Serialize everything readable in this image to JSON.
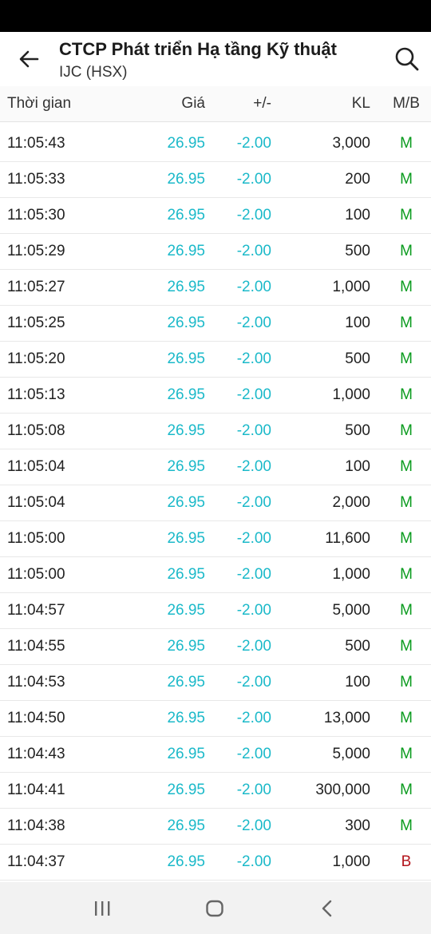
{
  "header": {
    "title": "CTCP Phát triển Hạ tầng Kỹ thuật",
    "subtitle": "IJC (HSX)",
    "back_icon": "arrow-left-icon",
    "search_icon": "search-icon"
  },
  "table": {
    "columns": {
      "time": "Thời gian",
      "price": "Giá",
      "change": "+/-",
      "volume": "KL",
      "side": "M/B"
    },
    "rows": [
      {
        "time": "11:05:43",
        "price": "26.95",
        "change": "-2.00",
        "volume": "3,000",
        "side": "M"
      },
      {
        "time": "11:05:33",
        "price": "26.95",
        "change": "-2.00",
        "volume": "200",
        "side": "M"
      },
      {
        "time": "11:05:30",
        "price": "26.95",
        "change": "-2.00",
        "volume": "100",
        "side": "M"
      },
      {
        "time": "11:05:29",
        "price": "26.95",
        "change": "-2.00",
        "volume": "500",
        "side": "M"
      },
      {
        "time": "11:05:27",
        "price": "26.95",
        "change": "-2.00",
        "volume": "1,000",
        "side": "M"
      },
      {
        "time": "11:05:25",
        "price": "26.95",
        "change": "-2.00",
        "volume": "100",
        "side": "M"
      },
      {
        "time": "11:05:20",
        "price": "26.95",
        "change": "-2.00",
        "volume": "500",
        "side": "M"
      },
      {
        "time": "11:05:13",
        "price": "26.95",
        "change": "-2.00",
        "volume": "1,000",
        "side": "M"
      },
      {
        "time": "11:05:08",
        "price": "26.95",
        "change": "-2.00",
        "volume": "500",
        "side": "M"
      },
      {
        "time": "11:05:04",
        "price": "26.95",
        "change": "-2.00",
        "volume": "100",
        "side": "M"
      },
      {
        "time": "11:05:04",
        "price": "26.95",
        "change": "-2.00",
        "volume": "2,000",
        "side": "M"
      },
      {
        "time": "11:05:00",
        "price": "26.95",
        "change": "-2.00",
        "volume": "11,600",
        "side": "M"
      },
      {
        "time": "11:05:00",
        "price": "26.95",
        "change": "-2.00",
        "volume": "1,000",
        "side": "M"
      },
      {
        "time": "11:04:57",
        "price": "26.95",
        "change": "-2.00",
        "volume": "5,000",
        "side": "M"
      },
      {
        "time": "11:04:55",
        "price": "26.95",
        "change": "-2.00",
        "volume": "500",
        "side": "M"
      },
      {
        "time": "11:04:53",
        "price": "26.95",
        "change": "-2.00",
        "volume": "100",
        "side": "M"
      },
      {
        "time": "11:04:50",
        "price": "26.95",
        "change": "-2.00",
        "volume": "13,000",
        "side": "M"
      },
      {
        "time": "11:04:43",
        "price": "26.95",
        "change": "-2.00",
        "volume": "5,000",
        "side": "M"
      },
      {
        "time": "11:04:41",
        "price": "26.95",
        "change": "-2.00",
        "volume": "300,000",
        "side": "M"
      },
      {
        "time": "11:04:38",
        "price": "26.95",
        "change": "-2.00",
        "volume": "300",
        "side": "M"
      },
      {
        "time": "11:04:37",
        "price": "26.95",
        "change": "-2.00",
        "volume": "1,000",
        "side": "B"
      }
    ]
  },
  "colors": {
    "price": "#1bb9c9",
    "buy_m": "#0a9b1e",
    "sell_b": "#b3141b"
  },
  "navigation": {
    "recent_icon": "recent-apps-icon",
    "home_icon": "home-icon",
    "back_icon": "nav-back-icon"
  }
}
